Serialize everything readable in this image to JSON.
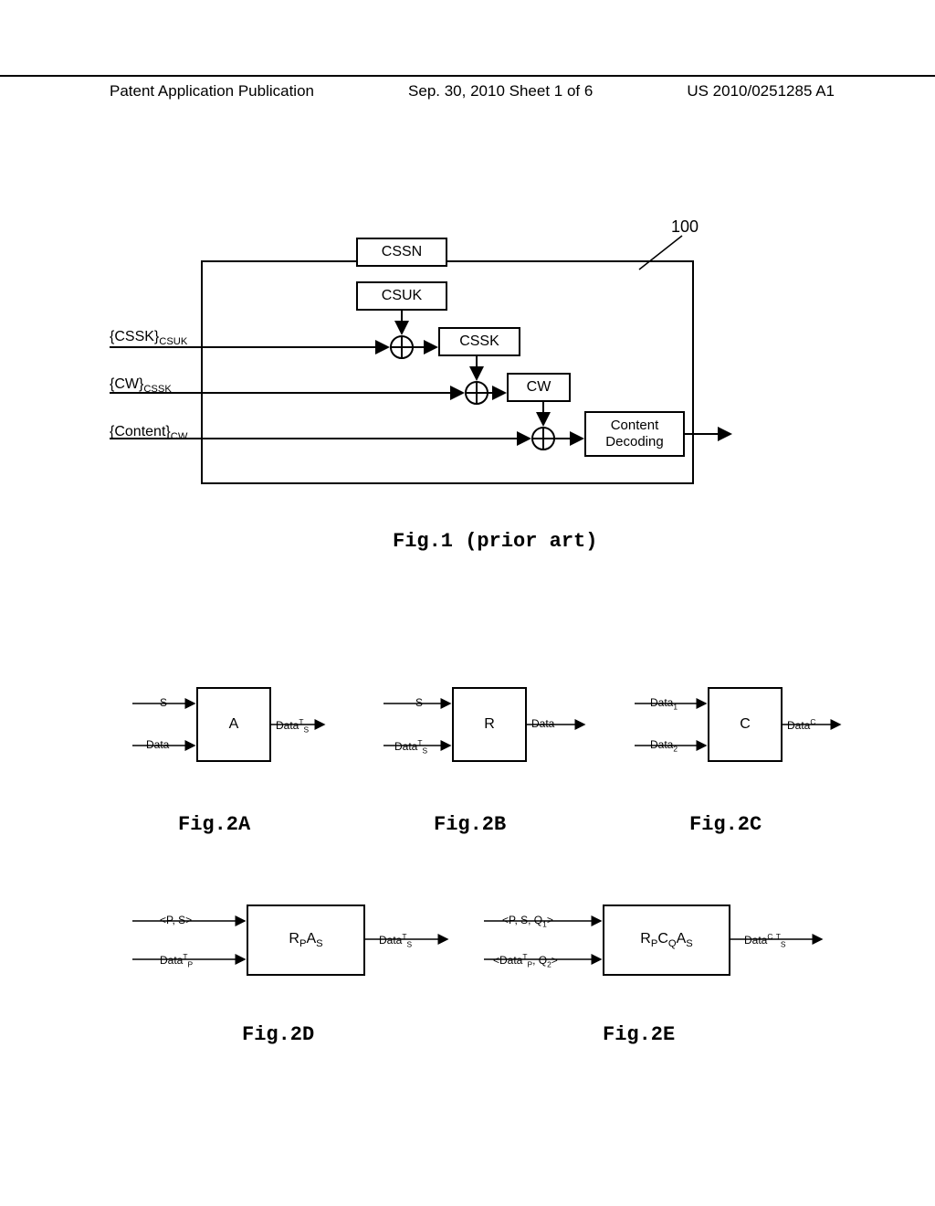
{
  "header": {
    "left": "Patent Application Publication",
    "center": "Sep. 30, 2010  Sheet 1 of 6",
    "right": "US 2010/0251285 A1"
  },
  "fig1": {
    "ref_num": "100",
    "boxes": {
      "cssn": "CSSN",
      "csuk": "CSUK",
      "cssk": "CSSK",
      "cw": "CW",
      "decode": "Content Decoding"
    },
    "inputs": {
      "cssk": "{CSSK}",
      "cssk_sub": "CSUK",
      "cw": "{CW}",
      "cw_sub": "CSSK",
      "content": "{Content}",
      "content_sub": "CW"
    },
    "caption": "Fig.1 (prior art)"
  },
  "fig2a": {
    "box": "A",
    "in1": "S",
    "in2": "Data",
    "out": "Data",
    "out_sup": "T",
    "out_sub": "S",
    "caption": "Fig.2A"
  },
  "fig2b": {
    "box": "R",
    "in1": "S",
    "in2": "Data",
    "in2_sup": "T",
    "in2_sub": "S",
    "out": "Data",
    "caption": "Fig.2B"
  },
  "fig2c": {
    "box": "C",
    "in1": "Data",
    "in1_sub": "1",
    "in2": "Data",
    "in2_sub": "2",
    "out": "Data",
    "out_sup": "C",
    "caption": "Fig.2C"
  },
  "fig2d": {
    "box": "R",
    "box_sub1": "P",
    "box2": "A",
    "box_sub2": "S",
    "in1": "<P, S>",
    "in2": "Data",
    "in2_sup": "T",
    "in2_sub": "P",
    "out": "Data",
    "out_sup": "T",
    "out_sub": "S",
    "caption": "Fig.2D"
  },
  "fig2e": {
    "box_r": "R",
    "box_r_sub": "P",
    "box_c": "C",
    "box_c_sub": "Q",
    "box_a": "A",
    "box_a_sub": "S",
    "in1": "<P, S, Q",
    "in1_sub": "1",
    "in1_end": ">",
    "in2_start": "<Data",
    "in2_sup": "T",
    "in2_sub": "P",
    "in2_mid": ", Q",
    "in2_sub2": "2",
    "in2_end": ">",
    "out": "Data",
    "out_sup1": "C",
    "out_sup2": "T",
    "out_sub": "S",
    "caption": "Fig.2E"
  }
}
